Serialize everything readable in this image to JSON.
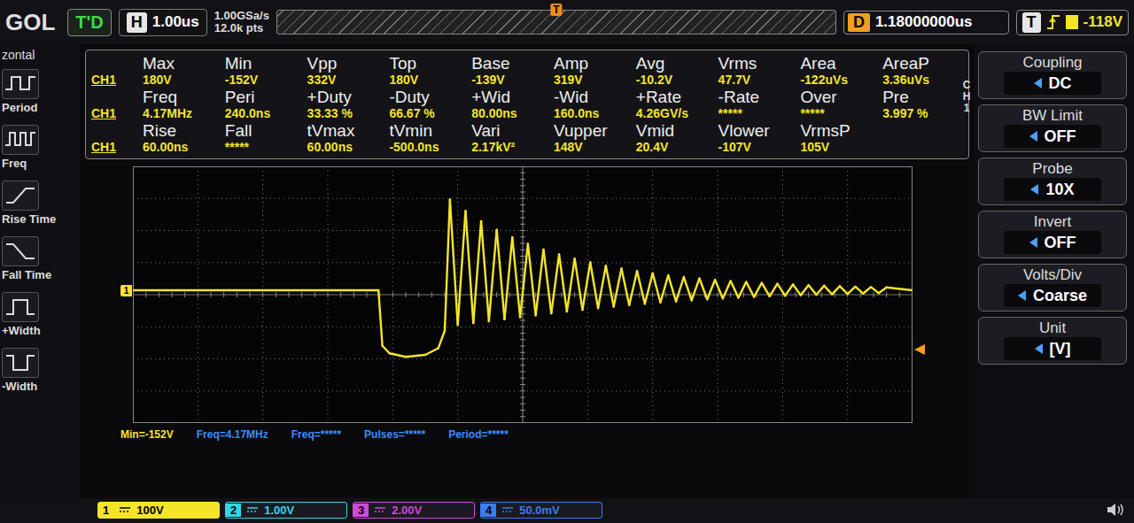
{
  "top_bar": {
    "logo": "GOL",
    "run_status": "T'D",
    "timebase": {
      "label": "H",
      "value": "1.00us"
    },
    "sample_rate": "1.00GSa/s",
    "memory_depth": "12.0k pts",
    "trigger_marker": "T",
    "delay": {
      "label": "D",
      "value": "1.18000000us"
    },
    "trigger": {
      "label": "T",
      "level": "-118V"
    }
  },
  "left_menu": {
    "title": "zontal",
    "items": [
      {
        "label": "Period"
      },
      {
        "label": "Freq"
      },
      {
        "label": "Rise Time"
      },
      {
        "label": "Fall Time"
      },
      {
        "label": "+Width"
      },
      {
        "label": "-Width"
      }
    ]
  },
  "measurements": {
    "channel": "CH1",
    "rows": [
      {
        "labels": [
          "Max",
          "Min",
          "Vpp",
          "Top",
          "Base",
          "Amp",
          "Avg",
          "Vrms",
          "Area",
          "AreaP"
        ],
        "values": [
          "180V",
          "-152V",
          "332V",
          "180V",
          "-139V",
          "319V",
          "-10.2V",
          "47.7V",
          "-122uVs",
          "3.36uVs"
        ]
      },
      {
        "labels": [
          "Freq",
          "Peri",
          "+Duty",
          "-Duty",
          "+Wid",
          "-Wid",
          "+Rate",
          "-Rate",
          "Over",
          "Pre"
        ],
        "values": [
          "4.17MHz",
          "240.0ns",
          "33.33 %",
          "66.67 %",
          "80.00ns",
          "160.0ns",
          "4.26GV/s",
          "*****",
          "*****",
          "3.997 %"
        ]
      },
      {
        "labels": [
          "Rise",
          "Fall",
          "tVmax",
          "tVmin",
          "Vari",
          "Vupper",
          "Vmid",
          "Vlower",
          "VrmsP"
        ],
        "values": [
          "60.00ns",
          "*****",
          "60.00ns",
          "-500.0ns",
          "2.17kV²",
          "148V",
          "20.4V",
          "-107V",
          "105V"
        ]
      }
    ]
  },
  "plot": {
    "ground_marker": "1",
    "series": [
      {
        "name": "CH1",
        "color": "#f5e52a",
        "time_us": [
          0,
          3.78,
          3.84,
          3.95,
          4.2,
          4.5,
          4.7,
          4.8,
          4.88,
          5.0,
          5.12,
          5.24,
          5.36,
          5.48,
          5.6,
          5.72,
          5.84,
          5.96,
          6.08,
          6.2,
          6.32,
          6.44,
          6.56,
          6.68,
          6.8,
          6.92,
          7.04,
          7.16,
          7.28,
          7.4,
          7.52,
          7.64,
          7.76,
          7.88,
          8.0,
          8.12,
          8.24,
          8.36,
          8.48,
          8.6,
          8.72,
          8.84,
          8.96,
          9.08,
          9.2,
          9.32,
          9.44,
          9.56,
          9.68,
          9.8,
          9.92,
          10.04,
          10.16,
          10.28,
          10.4,
          10.52,
          10.64,
          10.76,
          10.88,
          11.0,
          11.12,
          11.24,
          11.36,
          11.48,
          11.6,
          12.0
        ],
        "volts": [
          0,
          0,
          -110,
          -125,
          -132,
          -128,
          -115,
          -80,
          180,
          -68.5,
          156.9,
          -65.2,
          137.1,
          -61.4,
          119.9,
          -57.5,
          105.0,
          -53.5,
          92.0,
          -49.7,
          80.9,
          -45.8,
          71.1,
          -42.1,
          62.6,
          -38.7,
          55.2,
          -35.4,
          48.6,
          -32.3,
          43.0,
          -29.4,
          38.0,
          -26.7,
          33.6,
          -24.2,
          29.7,
          -22.0,
          26.3,
          -19.9,
          23.4,
          -18.0,
          20.7,
          -16.3,
          18.4,
          -14.7,
          16.4,
          -13.2,
          14.6,
          -11.9,
          12.9,
          -10.8,
          11.5,
          -9.8,
          10.2,
          -8.9,
          9.0,
          -8.0,
          8.0,
          -7.2,
          7.1,
          -6.5,
          6.3,
          -5.8,
          5.6,
          0
        ]
      }
    ]
  },
  "bottom_readouts": [
    "Min=-152V",
    "Freq=4.17MHz",
    "Freq=*****",
    "Pulses=*****",
    "Period=*****"
  ],
  "channels": [
    {
      "number": "1",
      "scale": "100V",
      "color": "#f5e52a",
      "selected": true
    },
    {
      "number": "2",
      "scale": "1.00V",
      "color": "#33d6e6",
      "selected": false
    },
    {
      "number": "3",
      "scale": "2.00V",
      "color": "#d04ad8",
      "selected": false
    },
    {
      "number": "4",
      "scale": "50.0mV",
      "color": "#3c7cf0",
      "selected": false
    }
  ],
  "right_menu": {
    "channel_label": "CH1",
    "items": [
      {
        "label": "Coupling",
        "value": "DC"
      },
      {
        "label": "BW Limit",
        "value": "OFF"
      },
      {
        "label": "Probe",
        "value": "10X"
      },
      {
        "label": "Invert",
        "value": "OFF"
      },
      {
        "label": "Volts/Div",
        "value": "Coarse"
      },
      {
        "label": "Unit",
        "value": "[V]"
      }
    ]
  }
}
